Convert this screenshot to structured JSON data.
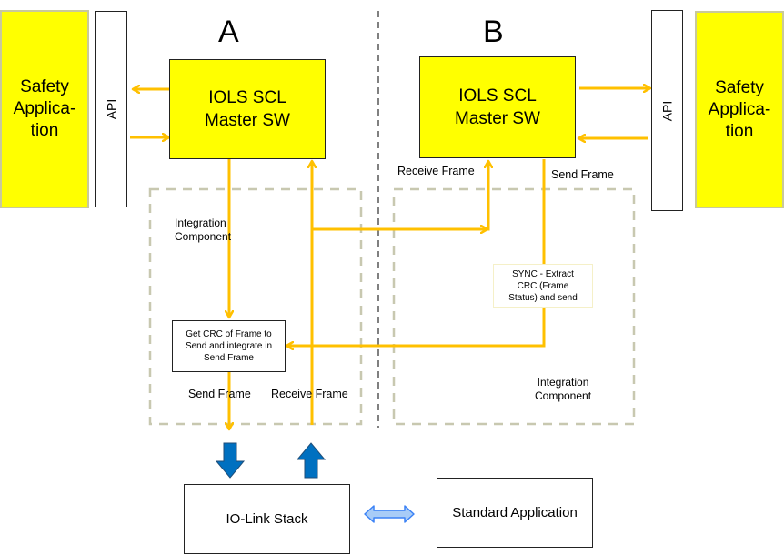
{
  "sections": {
    "a": "A",
    "b": "B"
  },
  "left": {
    "safety_app": [
      "Safety",
      "Applica-",
      "tion"
    ],
    "api": "API",
    "master": [
      "IOLS SCL",
      "Master SW"
    ],
    "integration_label": [
      "Integration",
      "Component"
    ],
    "crc_box": [
      "Get CRC of Frame to",
      "Send  and integrate in",
      "Send Frame"
    ],
    "send_frame": "Send Frame",
    "receive_frame": "Receive Frame"
  },
  "right": {
    "safety_app": [
      "Safety",
      "Applica-",
      "tion"
    ],
    "api": "API",
    "master": [
      "IOLS SCL",
      "Master SW"
    ],
    "receive_frame": "Receive Frame",
    "send_frame": "Send Frame",
    "sync_box": [
      "SYNC - Extract",
      "CRC (Frame",
      "Status) and send"
    ],
    "integration_label": [
      "Integration",
      "Component"
    ]
  },
  "bottom": {
    "io_link_stack": "IO-Link Stack",
    "standard_app": "Standard Application"
  },
  "colors": {
    "component_fill": "#ffff00",
    "flow_arrow": "#ffc000",
    "stack_arrow": "#0070c0",
    "bidirectional_arrow": "#9dc3f5",
    "dashed_border": "#c8c8b0",
    "divider": "#808080"
  }
}
